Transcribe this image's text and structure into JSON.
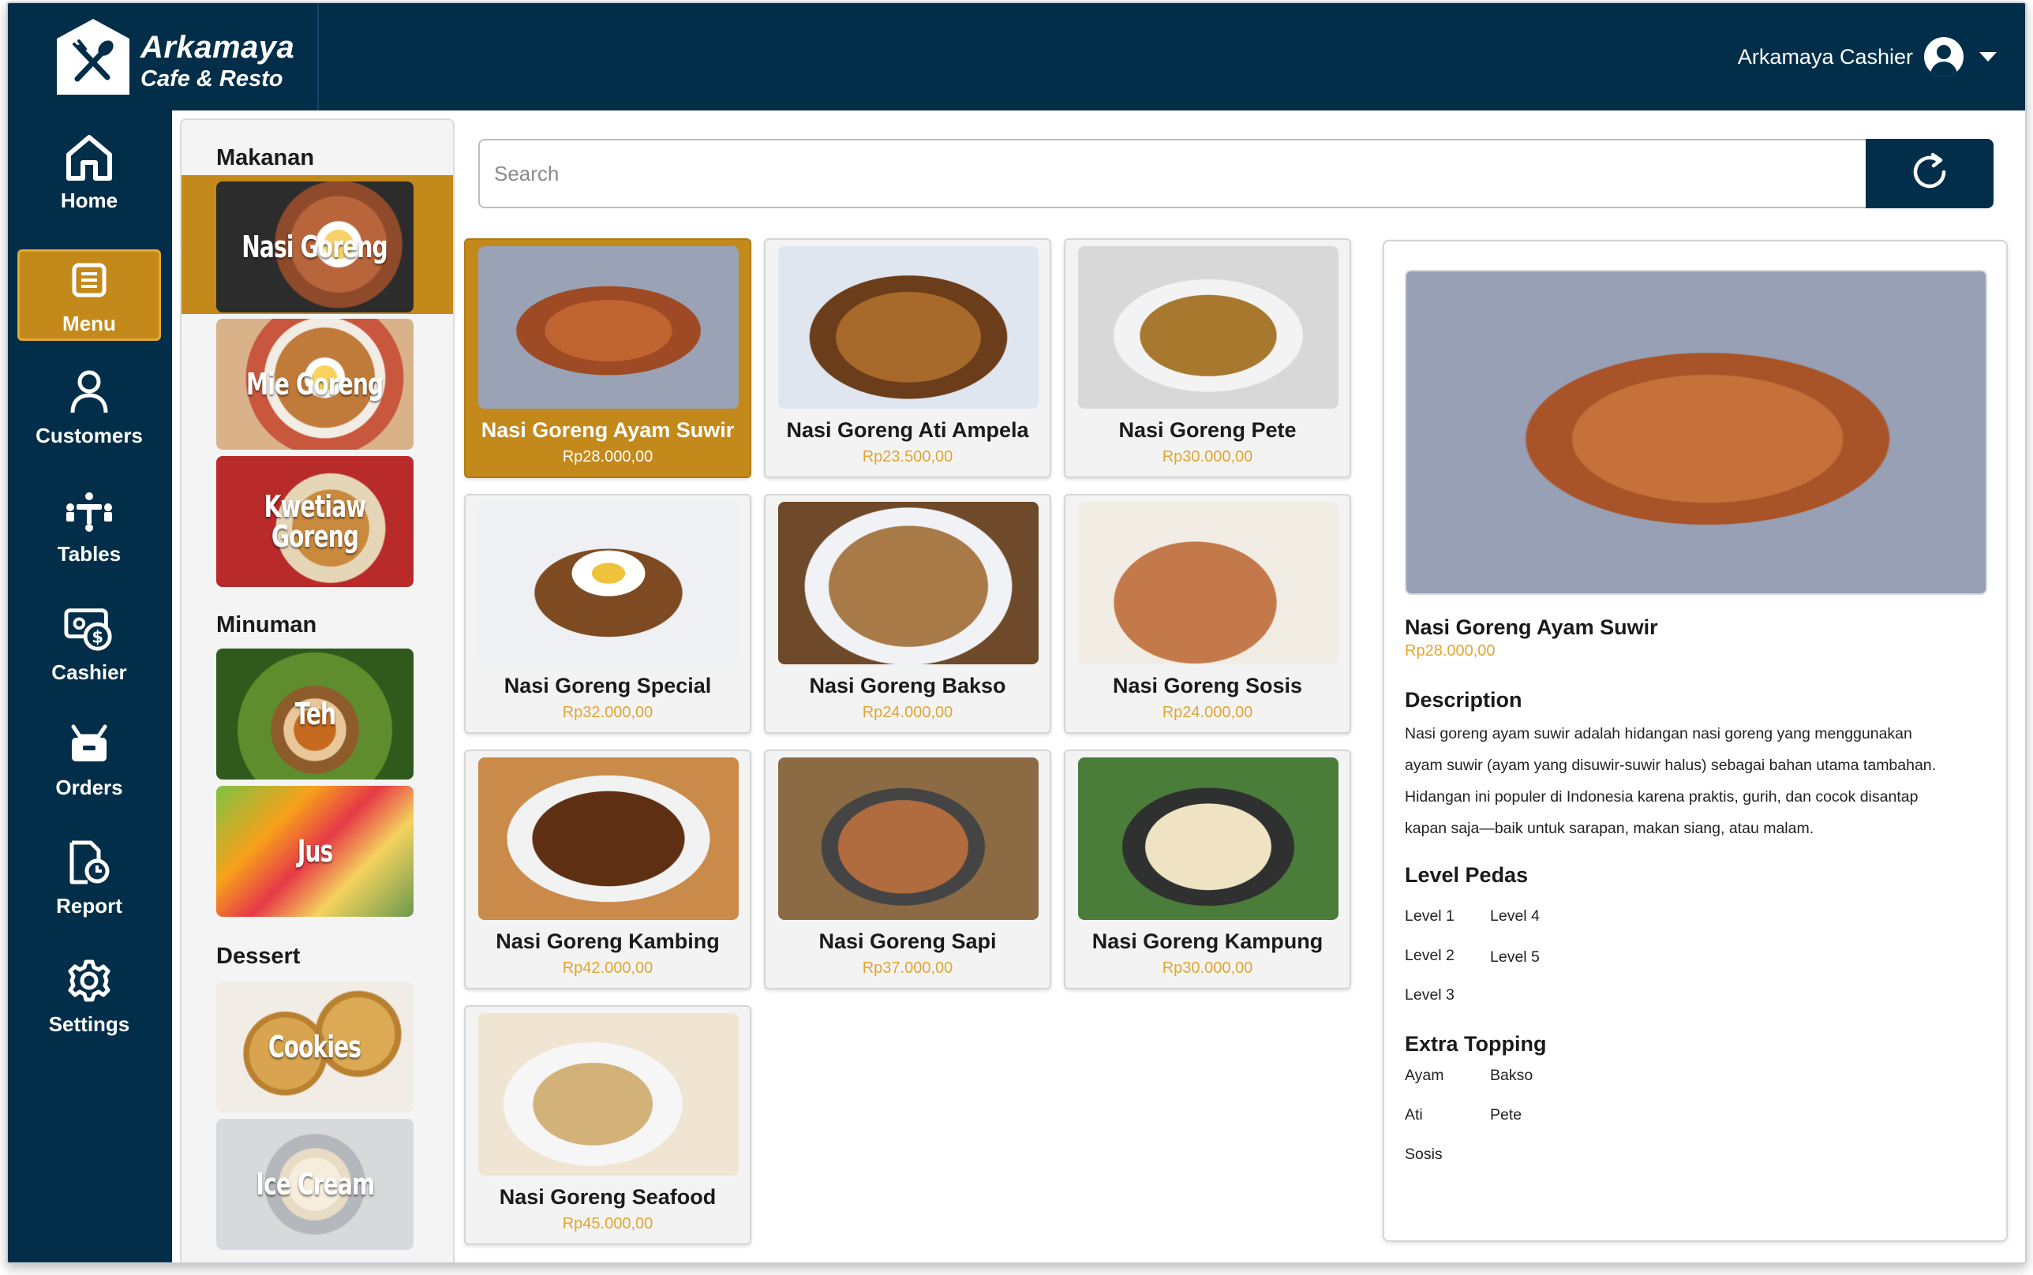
{
  "brand": {
    "name": "Arkamaya",
    "subtitle": "Cafe & Resto",
    "icon": "fork-knife-icon"
  },
  "header": {
    "user_name": "Arkamaya Cashier",
    "avatar_icon": "user-avatar-icon",
    "dropdown_icon": "chevron-down-icon"
  },
  "nav": [
    {
      "label": "Home",
      "icon": "home-icon",
      "active": false
    },
    {
      "label": "Menu",
      "icon": "menu-list-icon",
      "active": true
    },
    {
      "label": "Customers",
      "icon": "user-icon",
      "active": false
    },
    {
      "label": "Tables",
      "icon": "tables-icon",
      "active": false
    },
    {
      "label": "Cashier",
      "icon": "cash-register-icon",
      "active": false
    },
    {
      "label": "Orders",
      "icon": "basket-icon",
      "active": false
    },
    {
      "label": "Report",
      "icon": "report-icon",
      "active": false
    },
    {
      "label": "Settings",
      "icon": "gear-icon",
      "active": false
    }
  ],
  "categories": [
    {
      "heading": "Makanan",
      "items": [
        {
          "label": "Nasi Goreng",
          "active": true
        },
        {
          "label": "Mie Goreng",
          "active": false
        },
        {
          "label": "Kwetiaw Goreng",
          "active": false
        }
      ]
    },
    {
      "heading": "Minuman",
      "items": [
        {
          "label": "Teh",
          "active": false
        },
        {
          "label": "Jus",
          "active": false
        }
      ]
    },
    {
      "heading": "Dessert",
      "items": [
        {
          "label": "Cookies",
          "active": false
        },
        {
          "label": "Ice Cream",
          "active": false
        }
      ]
    }
  ],
  "search": {
    "placeholder": "Search",
    "value": "",
    "refresh_icon": "refresh-icon"
  },
  "products": [
    {
      "name": "Nasi Goreng Ayam Suwir",
      "price": "Rp28.000,00",
      "selected": true
    },
    {
      "name": "Nasi Goreng Ati Ampela",
      "price": "Rp23.500,00",
      "selected": false
    },
    {
      "name": "Nasi Goreng Pete",
      "price": "Rp30.000,00",
      "selected": false
    },
    {
      "name": "Nasi Goreng Special",
      "price": "Rp32.000,00",
      "selected": false
    },
    {
      "name": "Nasi Goreng Bakso",
      "price": "Rp24.000,00",
      "selected": false
    },
    {
      "name": "Nasi Goreng Sosis",
      "price": "Rp24.000,00",
      "selected": false
    },
    {
      "name": "Nasi Goreng Kambing",
      "price": "Rp42.000,00",
      "selected": false
    },
    {
      "name": "Nasi Goreng Sapi",
      "price": "Rp37.000,00",
      "selected": false
    },
    {
      "name": "Nasi Goreng Kampung",
      "price": "Rp30.000,00",
      "selected": false
    },
    {
      "name": "Nasi Goreng Seafood",
      "price": "Rp45.000,00",
      "selected": false
    }
  ],
  "detail": {
    "name": "Nasi Goreng Ayam Suwir",
    "price": "Rp28.000,00",
    "description_heading": "Description",
    "description_lines": [
      "Nasi goreng ayam suwir adalah hidangan nasi goreng yang menggunakan",
      "ayam suwir (ayam yang disuwir-suwir halus) sebagai bahan utama tambahan.",
      "Hidangan ini populer di Indonesia karena praktis, gurih, dan cocok disantap",
      "kapan saja—baik untuk sarapan, makan siang, atau malam."
    ],
    "spice_heading": "Level Pedas",
    "spice_levels": [
      "Level 1",
      "Level 2",
      "Level 3",
      "Level 4",
      "Level 5"
    ],
    "topping_heading": "Extra Topping",
    "toppings": [
      "Ayam",
      "Ati",
      "Sosis",
      "Bakso",
      "Pete"
    ]
  },
  "colors": {
    "navy": "#022e4a",
    "accent": "#c3891a",
    "price": "#e1a632"
  }
}
